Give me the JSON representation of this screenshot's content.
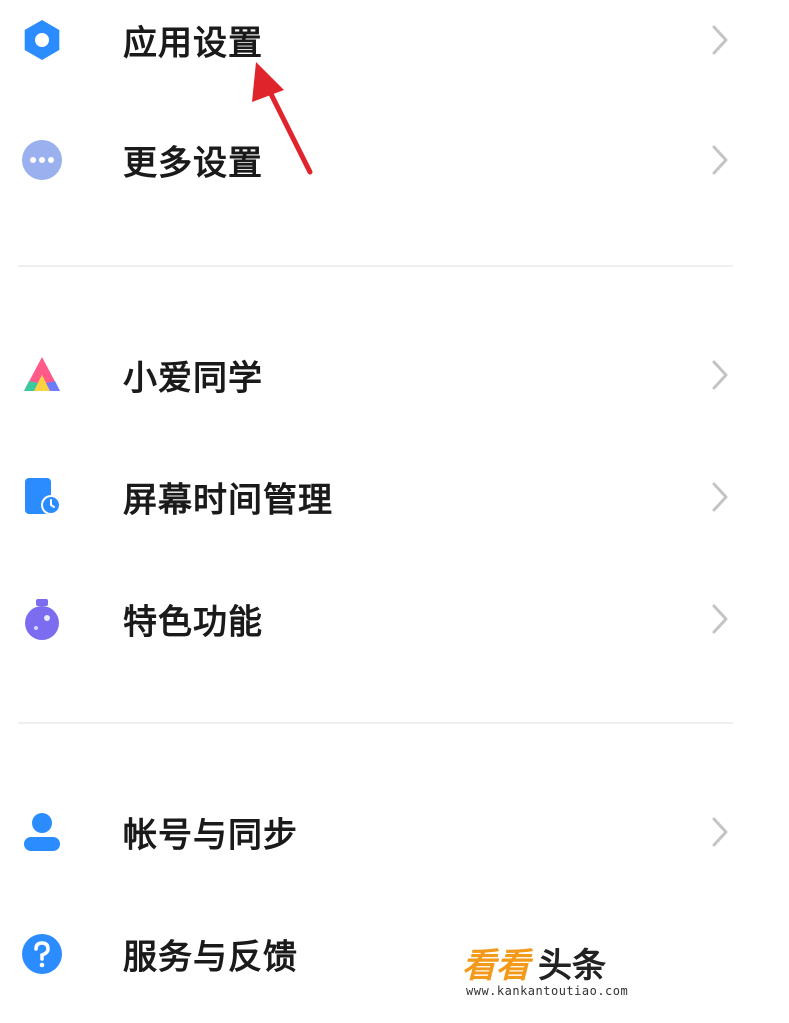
{
  "settings_groups": [
    {
      "items": [
        {
          "label": "应用设置",
          "icon": "gear-icon",
          "color": "#2b8cff"
        },
        {
          "label": "更多设置",
          "icon": "more-dots-icon",
          "color": "#9bb1ef"
        }
      ]
    },
    {
      "items": [
        {
          "label": "小爱同学",
          "icon": "xiaoai-icon",
          "color": "#ff5a8a"
        },
        {
          "label": "屏幕时间管理",
          "icon": "screen-time-icon",
          "color": "#2b8cff"
        },
        {
          "label": "特色功能",
          "icon": "flask-icon",
          "color": "#7b6cf0"
        }
      ]
    },
    {
      "items": [
        {
          "label": "帐号与同步",
          "icon": "user-icon",
          "color": "#2b8cff"
        },
        {
          "label": "服务与反馈",
          "icon": "help-icon",
          "color": "#2b8cff"
        }
      ]
    }
  ],
  "annotation": {
    "icon": "red-arrow-icon",
    "color": "#e0242c"
  },
  "watermark": {
    "brand_accent": "看看",
    "brand_main": "头条",
    "url": "www.kankantoutiao.com",
    "accent_color": "#f39a1b"
  },
  "chevron_color": "#c4c4c4"
}
